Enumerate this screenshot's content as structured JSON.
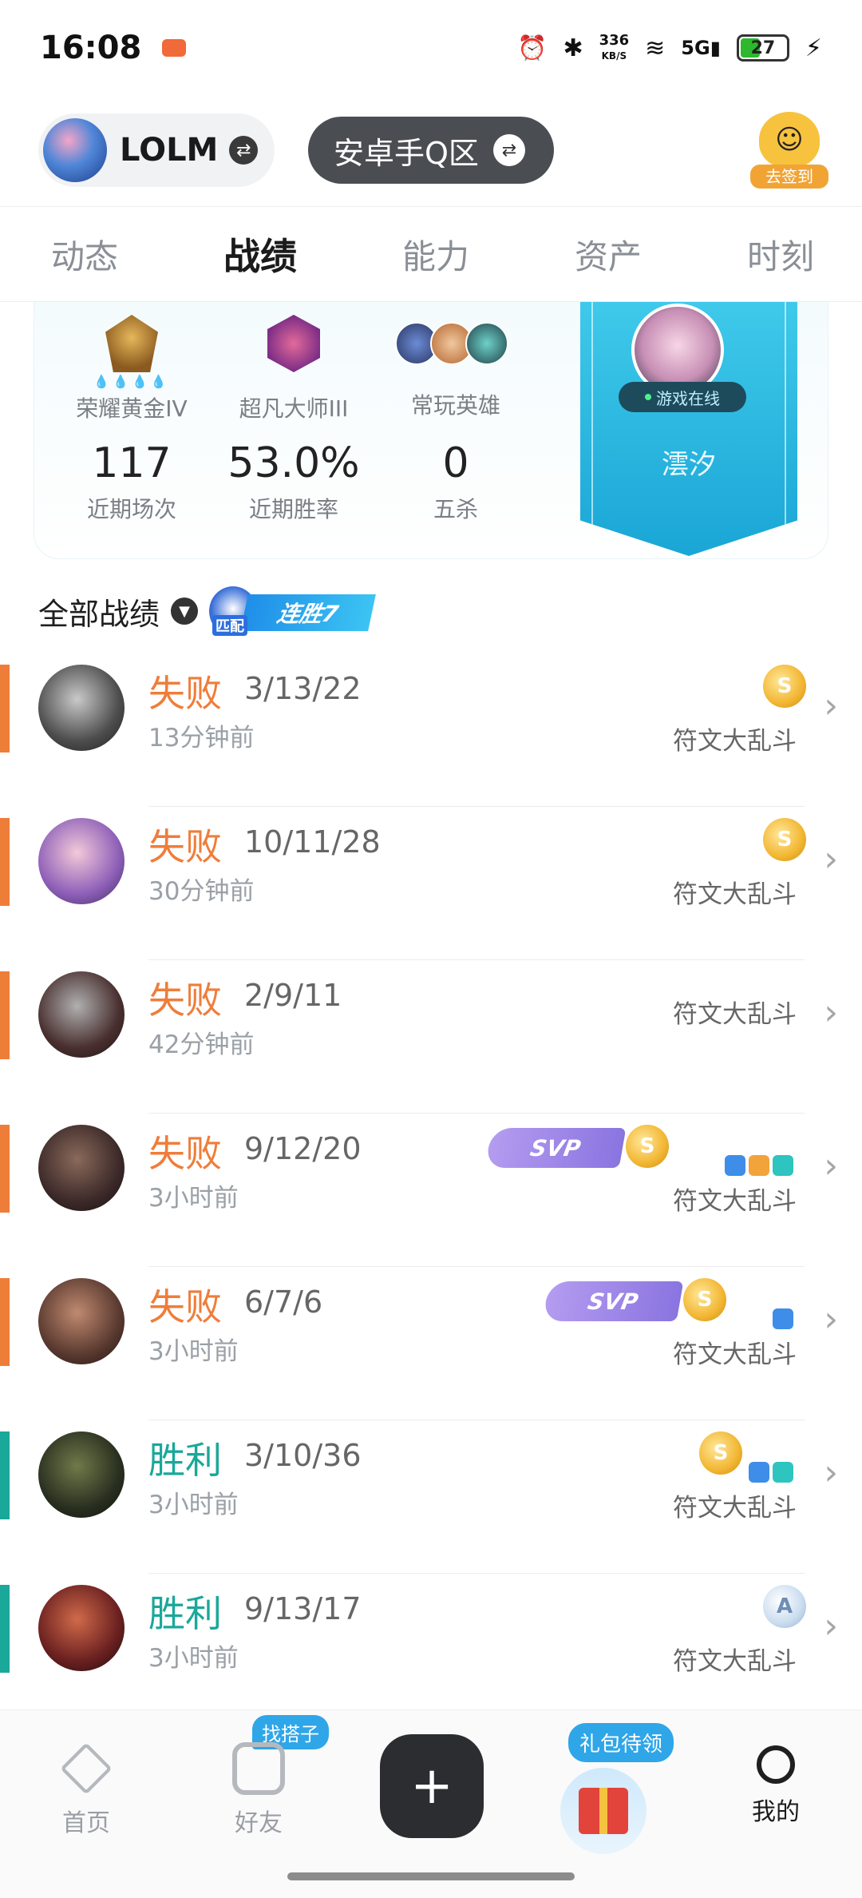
{
  "status_bar": {
    "time": "16:08",
    "net_speed_value": "336",
    "net_speed_unit": "KB/S",
    "signal": "5G",
    "battery": "27"
  },
  "header": {
    "game_name": "LOLM",
    "region": "安卓手Q区",
    "signin_label": "去签到"
  },
  "tabs": [
    {
      "label": "动态"
    },
    {
      "label": "战绩"
    },
    {
      "label": "能力"
    },
    {
      "label": "资产"
    },
    {
      "label": "时刻"
    }
  ],
  "active_tab": "战绩",
  "ranks": [
    {
      "label": "荣耀黄金IV",
      "drops": "💧💧💧💧"
    },
    {
      "label": "超凡大师III"
    },
    {
      "label": "常玩英雄"
    }
  ],
  "stats": [
    {
      "value": "117",
      "label": "近期场次"
    },
    {
      "value": "53.0%",
      "label": "近期胜率"
    },
    {
      "value": "0",
      "label": "五杀"
    }
  ],
  "profile": {
    "online_status": "游戏在线",
    "name": "澐汐"
  },
  "records_header": {
    "title": "全部战绩",
    "streak_mode": "匹配",
    "streak_label": "连胜7"
  },
  "colors": {
    "loss": "#ef7d3a",
    "win": "#1aa89a"
  },
  "records": [
    {
      "result": "失败",
      "kda": "3/13/22",
      "time": "13分钟前",
      "mode": "符文大乱斗",
      "coin": "S",
      "svp": "",
      "badges": ""
    },
    {
      "result": "失败",
      "kda": "10/11/28",
      "time": "30分钟前",
      "mode": "符文大乱斗",
      "coin": "S",
      "svp": "",
      "badges": ""
    },
    {
      "result": "失败",
      "kda": "2/9/11",
      "time": "42分钟前",
      "mode": "符文大乱斗",
      "coin": "",
      "svp": "",
      "badges": ""
    },
    {
      "result": "失败",
      "kda": "9/12/20",
      "time": "3小时前",
      "mode": "符文大乱斗",
      "coin": "S",
      "svp": "SVP",
      "badges": "3"
    },
    {
      "result": "失败",
      "kda": "6/7/6",
      "time": "3小时前",
      "mode": "符文大乱斗",
      "coin": "S",
      "svp": "SVP",
      "badges": "1"
    },
    {
      "result": "胜利",
      "kda": "3/10/36",
      "time": "3小时前",
      "mode": "符文大乱斗",
      "coin": "S",
      "svp": "",
      "badges": "2"
    },
    {
      "result": "胜利",
      "kda": "9/13/17",
      "time": "3小时前",
      "mode": "符文大乱斗",
      "coin": "A",
      "svp": "",
      "badges": ""
    }
  ],
  "bottom_nav": {
    "home": "首页",
    "friends": "好友",
    "friends_tag": "找搭子",
    "create": "+",
    "gift_tag": "礼包待领",
    "me": "我的"
  }
}
